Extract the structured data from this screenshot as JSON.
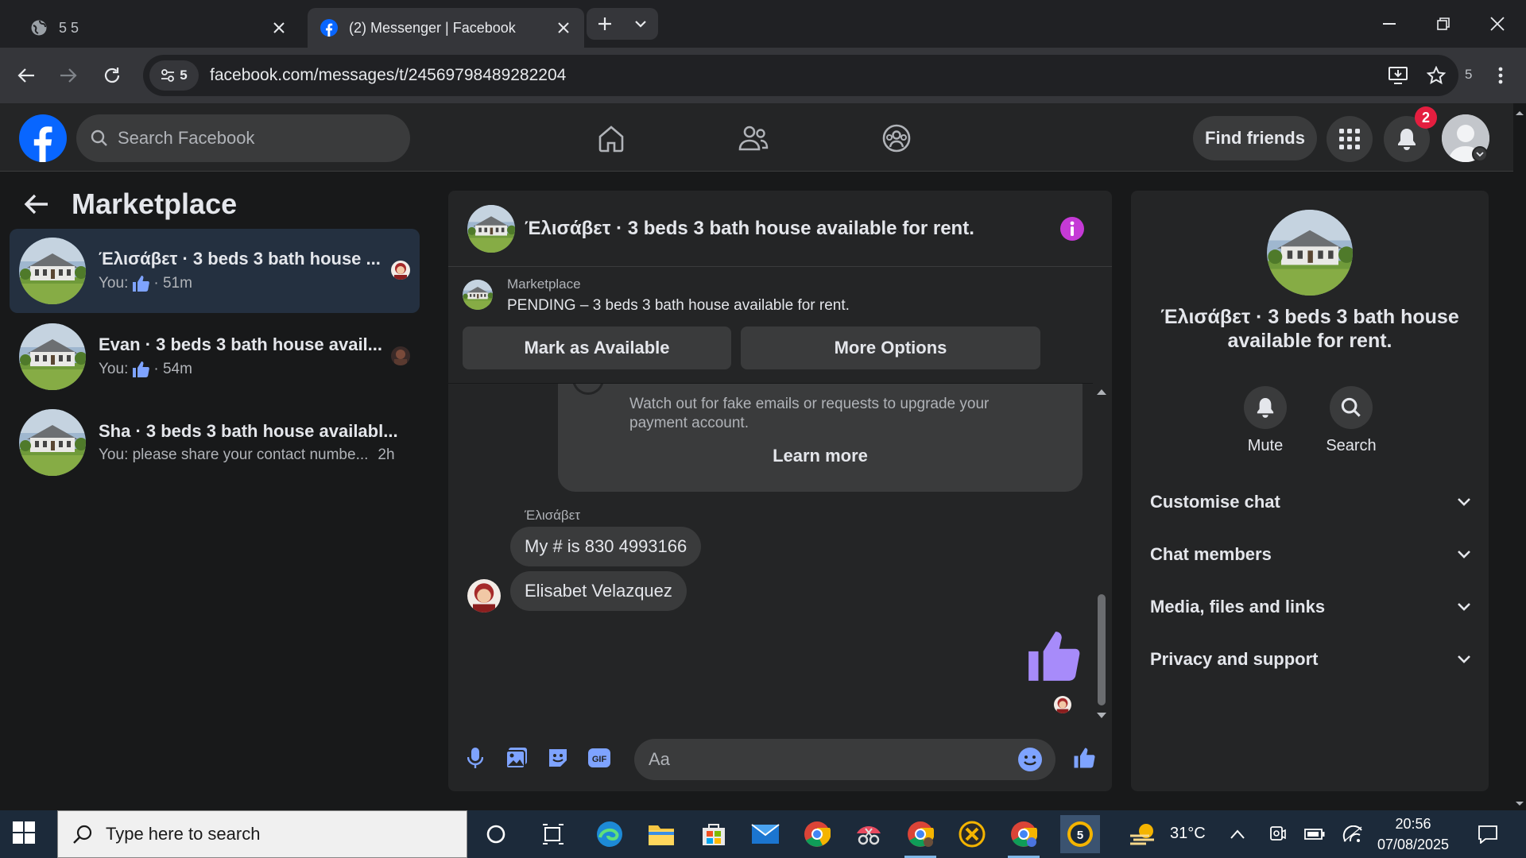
{
  "browser": {
    "tabs": [
      {
        "title": "5 5",
        "active": false
      },
      {
        "title": "(2) Messenger | Facebook",
        "active": true
      }
    ],
    "site_info_count": "5",
    "url": "facebook.com/messages/t/24569798489282204",
    "profile_count": "5"
  },
  "facebook": {
    "search_placeholder": "Search Facebook",
    "find_friends": "Find friends",
    "notification_count": "2",
    "brand_color": "#0866ff"
  },
  "sidebar": {
    "title": "Marketplace",
    "conversations": [
      {
        "title": "Έλισάβετ · 3 beds 3 bath house ...",
        "prefix": "You:",
        "time": "· 51m",
        "icon": "thumbs-up-icon",
        "selected": true
      },
      {
        "title": "Evan · 3 beds 3 bath house avail...",
        "prefix": "You:",
        "time": "· 54m",
        "icon": "thumbs-up-icon",
        "selected": false
      },
      {
        "title": "Sha · 3 beds 3 bath house availabl...",
        "prefix": "You: please share your contact numbe...",
        "time": "2h",
        "selected": false
      }
    ]
  },
  "chat": {
    "title": "Έλισάβετ · 3 beds 3 bath house available for rent.",
    "marketplace_label": "Marketplace",
    "listing_status": "PENDING – 3 beds 3 bath house available for rent.",
    "mark_available": "Mark as Available",
    "more_options": "More Options",
    "safety_text": "Watch out for fake emails or requests to upgrade your payment account.",
    "learn_more": "Learn more",
    "sender_name": "Έλισάβετ",
    "messages": [
      "My # is 830 4993166",
      "Elisabet Velazquez"
    ],
    "composer_placeholder": "Aa",
    "accent_color": "#a78bfa"
  },
  "info_panel": {
    "title": "Έλισάβετ · 3 beds 3 bath house available for rent.",
    "actions": [
      "Mute",
      "Search"
    ],
    "sections": [
      "Customise chat",
      "Chat members",
      "Media, files and links",
      "Privacy and support"
    ]
  },
  "taskbar": {
    "search_placeholder": "Type here to search",
    "weather": "31°C",
    "time": "20:56",
    "date": "07/08/2025",
    "badge": "5"
  }
}
